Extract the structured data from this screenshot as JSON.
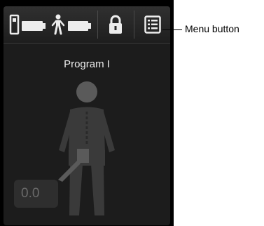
{
  "screen": {
    "program_title": "Program I",
    "amplitude_value": "0.0"
  },
  "topbar": {
    "icons": [
      "remote-battery-icon",
      "patient-stimulator-battery-icon",
      "lock-icon",
      "menu-icon"
    ],
    "battery_remote_level": 1.0,
    "battery_stimulator_level": 1.0
  },
  "annotation": {
    "menu_button_label": "Menu button"
  },
  "colors": {
    "screen_bg": "#1c1c1c",
    "icon": "#ededed",
    "figure": "#3a3a3a",
    "head": "#5a5a5a"
  }
}
